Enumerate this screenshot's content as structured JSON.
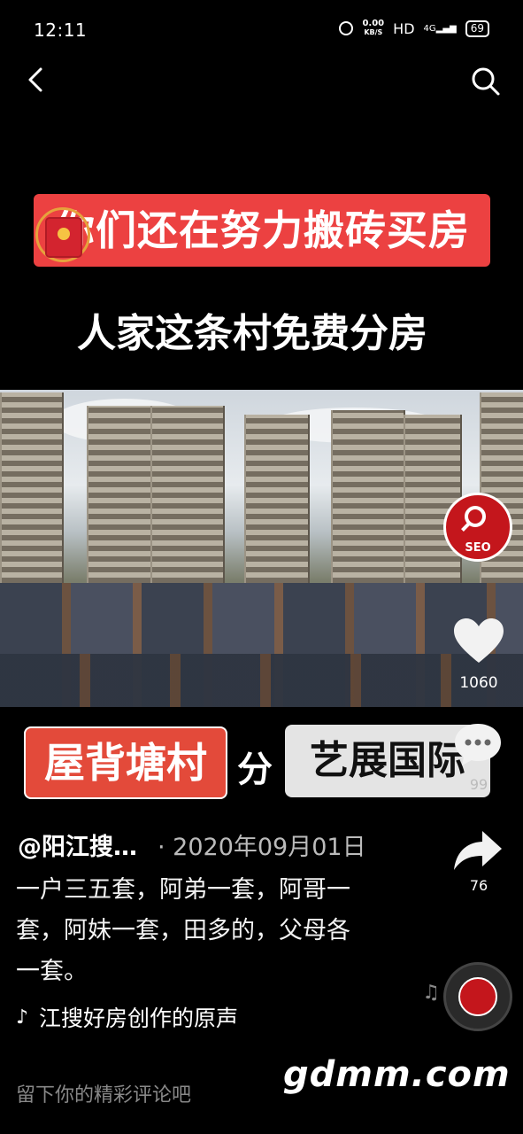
{
  "status_bar": {
    "time": "12:11",
    "net_speed_value": "0.00",
    "net_speed_unit": "KB/S",
    "hd_label": "HD",
    "signal_label": "4G",
    "battery": "69"
  },
  "video": {
    "banner_line1": "你们还在努力搬砖买房",
    "banner_line2": "人家这条村免费分房",
    "tag_left": "屋背塘村",
    "tag_middle": "分",
    "tag_right": "艺展国际"
  },
  "actions": {
    "seo_label": "SEO",
    "likes": "1060",
    "comments": "99",
    "shares": "76"
  },
  "post": {
    "author": "@阳江搜…",
    "date": "· 2020年09月01日",
    "description": "一户三五套，阿弟一套，阿哥一套，阿妹一套，田多的，父母各一套。",
    "music": "江搜好房创作的原声"
  },
  "footer": {
    "comment_placeholder": "留下你的精彩评论吧",
    "watermark": "gdmm.com"
  },
  "colors": {
    "accent_red": "#ec4141",
    "tag_red": "#e34a3a",
    "seo_red": "#c4161c"
  }
}
